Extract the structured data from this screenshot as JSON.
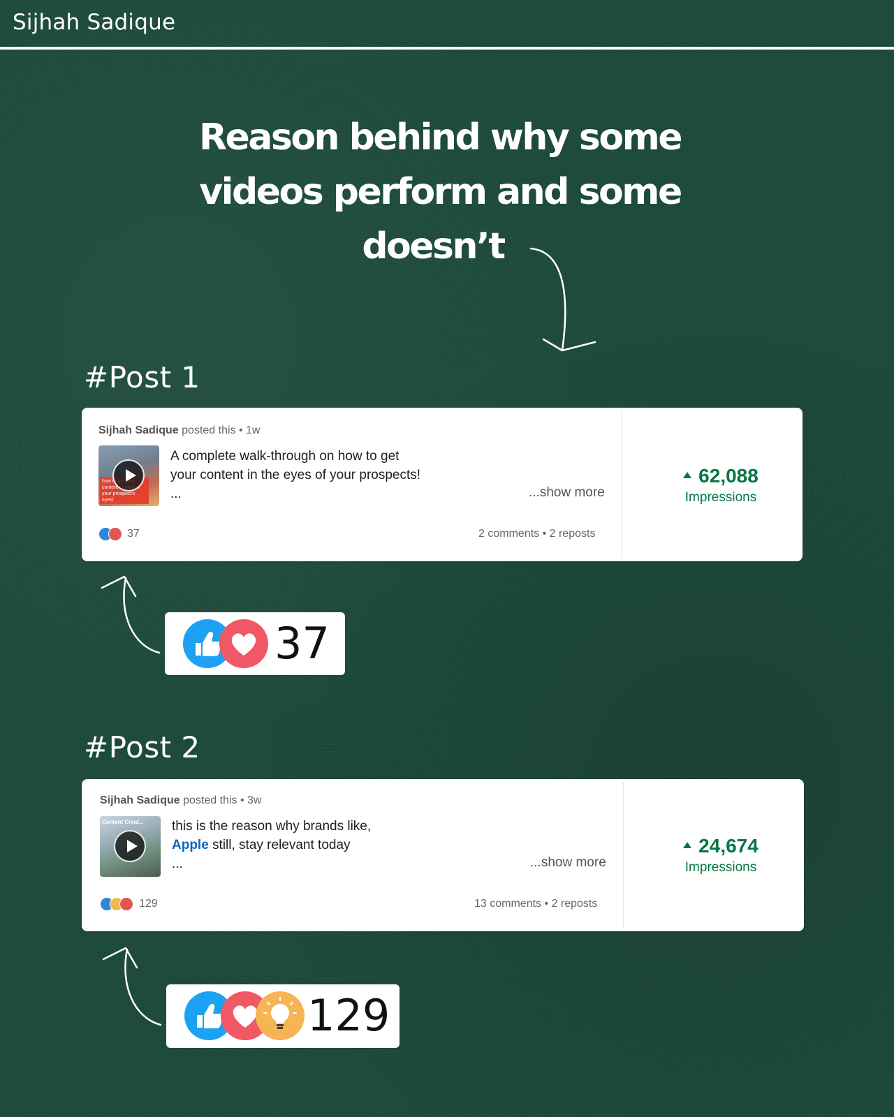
{
  "header": {
    "author": "Sijhah Sadique",
    "title": "Reason behind why some videos perform and some doesn’t",
    "title_lines": [
      "Reason behind why some",
      "videos perform and some",
      "doesn’t"
    ]
  },
  "posts": [
    {
      "heading": "#Post 1",
      "author": "Sijhah Sadique",
      "meta_suffix": "posted this • 1w",
      "thumbnail_overlay": "how to get your content in front of your prospect's eyes!",
      "text_lines": [
        "A complete walk-through on how to get",
        "your content in the eyes of your prospects!",
        "..."
      ],
      "show_more": "...show more",
      "reaction_count": "37",
      "social": "2 comments • 2 reposts",
      "impressions_value": "62,088",
      "impressions_label": "Impressions",
      "reactions": [
        "like-icon",
        "love-icon"
      ],
      "big_count": "37"
    },
    {
      "heading": "#Post 2",
      "author": "Sijhah Sadique",
      "meta_suffix": "posted this • 3w",
      "thumbnail_overlay": "Content Creat...",
      "text_line1": "this is the reason why brands like,",
      "text_mention": "Apple",
      "text_line2_rest": " still, stay relevant today",
      "text_line3": "...",
      "show_more": "...show more",
      "reaction_count": "129",
      "social": "13 comments • 2 reposts",
      "impressions_value": "24,674",
      "impressions_label": "Impressions",
      "reactions": [
        "like-icon",
        "love-icon",
        "insightful-icon"
      ],
      "big_count": "129"
    }
  ],
  "colors": {
    "background": "#1d4a3a",
    "impressions_green": "#057642",
    "mention_blue": "#0a66c2",
    "like_blue": "#1da1f2",
    "love_red": "#f05866",
    "insightful_yellow": "#f6b455"
  }
}
